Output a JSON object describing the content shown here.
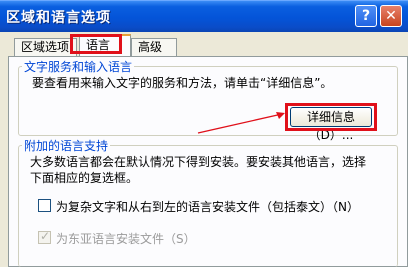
{
  "window": {
    "title": "区域和语言选项",
    "help_label": "?",
    "close_label": "✕"
  },
  "tabs": [
    {
      "label": "区域选项"
    },
    {
      "label": "语言"
    },
    {
      "label": "高级"
    }
  ],
  "text_services": {
    "title": "文字服务和输入语言",
    "description": "要查看用来输入文字的服务和方法，请单击“详细信息”。",
    "details_button": "详细信息（D）..."
  },
  "supplemental": {
    "title": "附加的语言支持",
    "description_line1": "大多数语言都会在默认情况下得到安装。要安装其他语言，选择",
    "description_line2": "下面相应的复选框。",
    "checkbox_complex": "为复杂文字和从右到左的语言安装文件（包括泰文）（N）",
    "checkbox_east_asian": "为东亚语言安装文件（S）"
  },
  "icons": {
    "help": "help-icon",
    "close": "close-icon",
    "check": "checkmark-icon"
  },
  "colors": {
    "titlebar": "#0454d8",
    "group_title": "#0046d5",
    "highlight": "#e0101a",
    "active_tab_accent": "#e6a03a"
  }
}
